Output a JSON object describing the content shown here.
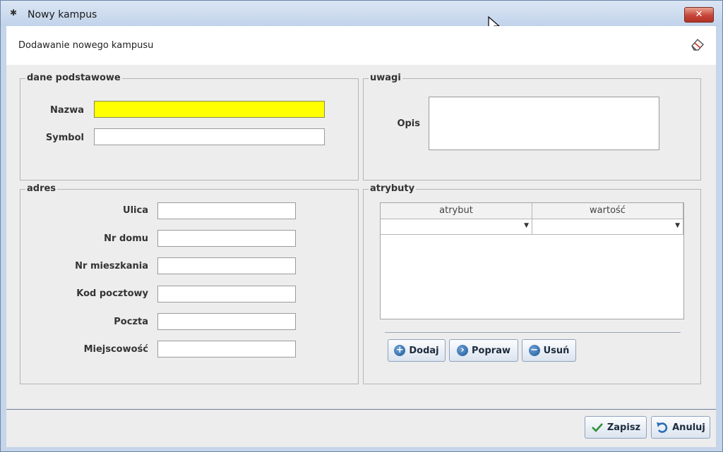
{
  "window": {
    "title": "Nowy kampus",
    "title_icon": "asterisk-icon",
    "close_label": "✕"
  },
  "header": {
    "title": "Dodawanie nowego kampusu",
    "icon": "eraser-icon"
  },
  "basic": {
    "legend": "dane podstawowe",
    "name_label": "Nazwa",
    "name_value": "",
    "symbol_label": "Symbol",
    "symbol_value": ""
  },
  "notes": {
    "legend": "uwagi",
    "desc_label": "Opis",
    "desc_value": ""
  },
  "address": {
    "legend": "adres",
    "street_label": "Ulica",
    "house_label": "Nr domu",
    "flat_label": "Nr mieszkania",
    "postcode_label": "Kod pocztowy",
    "post_office_label": "Poczta",
    "city_label": "Miejscowość"
  },
  "attributes": {
    "legend": "atrybuty",
    "columns": [
      "atrybut",
      "wartość"
    ],
    "add_label": "Dodaj",
    "edit_label": "Popraw",
    "remove_label": "Usuń"
  },
  "footer": {
    "save_label": "Zapisz",
    "cancel_label": "Anuluj"
  },
  "colors": {
    "required_field": "#ffff00",
    "title_bar": "#c1d3ea",
    "close_button": "#c7463a"
  }
}
